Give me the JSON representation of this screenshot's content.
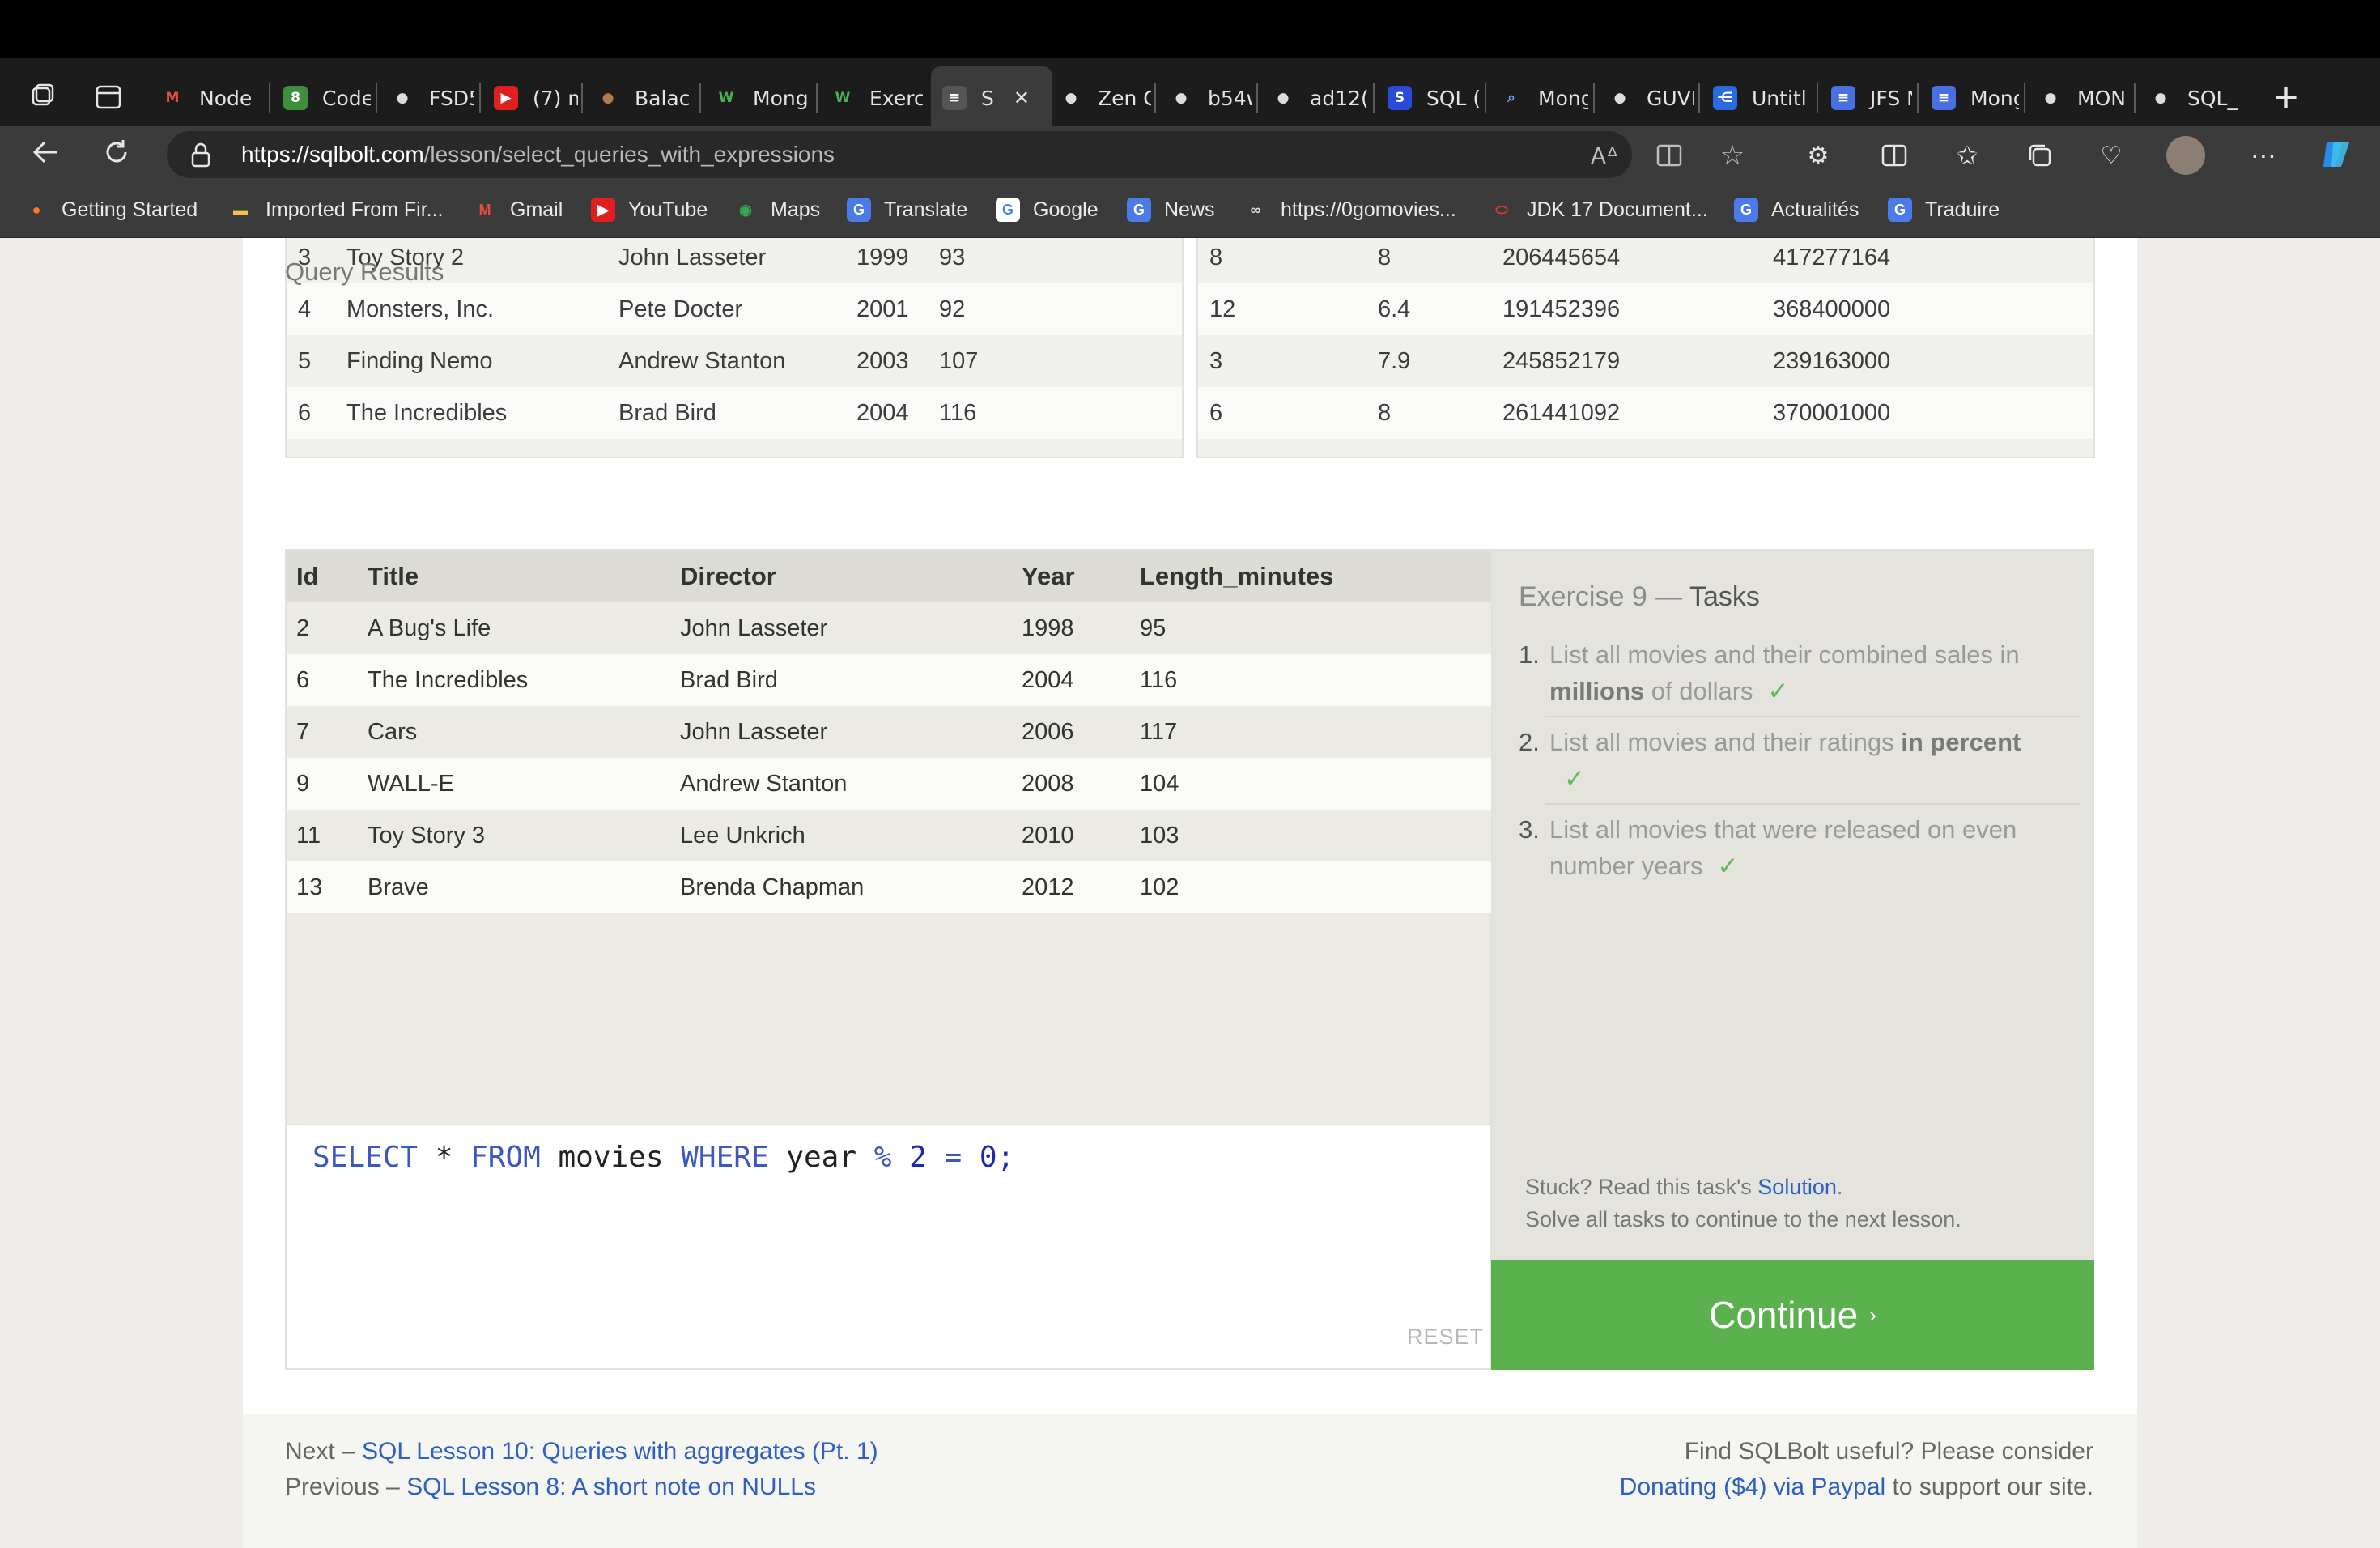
{
  "browser": {
    "tabs": [
      {
        "label": "Node",
        "icon": "gmail-icon"
      },
      {
        "label": "Code",
        "icon": "code-icon"
      },
      {
        "label": "FSD5",
        "icon": "github-icon"
      },
      {
        "label": "(7) m",
        "icon": "youtube-icon"
      },
      {
        "label": "Balac",
        "icon": "avatar-icon"
      },
      {
        "label": "Mong",
        "icon": "w3schools-icon"
      },
      {
        "label": "Exerc",
        "icon": "w3schools-icon"
      },
      {
        "label": "S",
        "icon": "sqlbolt-icon",
        "active": true
      },
      {
        "label": "Zen C",
        "icon": "github-icon"
      },
      {
        "label": "b54w",
        "icon": "github-icon"
      },
      {
        "label": "ad12(",
        "icon": "github-icon"
      },
      {
        "label": "SQL (",
        "icon": "sql-icon"
      },
      {
        "label": "Mong",
        "icon": "search-icon"
      },
      {
        "label": "GUVI",
        "icon": "github-icon"
      },
      {
        "label": "Untitl",
        "icon": "share-icon"
      },
      {
        "label": "JFS N",
        "icon": "docs-icon"
      },
      {
        "label": "Mong",
        "icon": "docs-icon"
      },
      {
        "label": "MON",
        "icon": "github-icon"
      },
      {
        "label": "SQL_",
        "icon": "github-icon"
      }
    ],
    "close_tab_glyph": "✕",
    "new_tab_glyph": "+",
    "url_host": "https://sqlbolt.com",
    "url_path": "/lesson/select_queries_with_expressions",
    "bookmarks": [
      {
        "label": "Getting Started",
        "icon": "firefox-icon"
      },
      {
        "label": "Imported From Fir...",
        "icon": "folder-icon"
      },
      {
        "label": "Gmail",
        "icon": "gmail-icon"
      },
      {
        "label": "YouTube",
        "icon": "youtube-icon"
      },
      {
        "label": "Maps",
        "icon": "maps-icon"
      },
      {
        "label": "Translate",
        "icon": "translate-icon"
      },
      {
        "label": "Google",
        "icon": "google-icon"
      },
      {
        "label": "News",
        "icon": "news-icon"
      },
      {
        "label": "https://0gomovies...",
        "icon": "movies-icon"
      },
      {
        "label": "JDK 17 Document...",
        "icon": "oracle-icon"
      },
      {
        "label": "Actualités",
        "icon": "news-icon"
      },
      {
        "label": "Traduire",
        "icon": "translate-icon"
      }
    ]
  },
  "movies_table": {
    "rows": [
      [
        "3",
        "Toy Story 2",
        "John Lasseter",
        "1999",
        "93"
      ],
      [
        "4",
        "Monsters, Inc.",
        "Pete Docter",
        "2001",
        "92"
      ],
      [
        "5",
        "Finding Nemo",
        "Andrew Stanton",
        "2003",
        "107"
      ],
      [
        "6",
        "The Incredibles",
        "Brad Bird",
        "2004",
        "116"
      ]
    ]
  },
  "boxoffice_table": {
    "rows": [
      [
        "8",
        "8",
        "206445654",
        "417277164"
      ],
      [
        "12",
        "6.4",
        "191452396",
        "368400000"
      ],
      [
        "3",
        "7.9",
        "245852179",
        "239163000"
      ],
      [
        "6",
        "8",
        "261441092",
        "370001000"
      ]
    ]
  },
  "results": {
    "label": "Query Results",
    "columns": [
      "Id",
      "Title",
      "Director",
      "Year",
      "Length_minutes"
    ],
    "rows": [
      [
        "2",
        "A Bug's Life",
        "John Lasseter",
        "1998",
        "95"
      ],
      [
        "6",
        "The Incredibles",
        "Brad Bird",
        "2004",
        "116"
      ],
      [
        "7",
        "Cars",
        "John Lasseter",
        "2006",
        "117"
      ],
      [
        "9",
        "WALL-E",
        "Andrew Stanton",
        "2008",
        "104"
      ],
      [
        "11",
        "Toy Story 3",
        "Lee Unkrich",
        "2010",
        "103"
      ],
      [
        "13",
        "Brave",
        "Brenda Chapman",
        "2012",
        "102"
      ]
    ]
  },
  "editor": {
    "query": "SELECT * FROM movies WHERE year % 2 = 0;",
    "reset_label": "RESET"
  },
  "tasks": {
    "title_prefix": "Exercise 9 — ",
    "title_strong": "Tasks",
    "items": [
      {
        "num": "1.",
        "pre": "List all movies and their combined sales in ",
        "bold": "millions",
        "post": " of dollars",
        "check": "✓"
      },
      {
        "num": "2.",
        "pre": "List all movies and their ratings ",
        "bold": "in percent",
        "post": "",
        "check": "✓"
      },
      {
        "num": "3.",
        "pre": "List all movies that were released on even number years",
        "bold": "",
        "post": "",
        "check": "✓"
      }
    ],
    "stuck_pre": "Stuck? Read this task's ",
    "stuck_link": "Solution",
    "stuck_post": ".",
    "solve_all": "Solve all tasks to continue to the next lesson.",
    "continue_label": "Continue",
    "continue_arrow": "›"
  },
  "footer": {
    "next_prefix": "Next – ",
    "next_link": "SQL Lesson 10: Queries with aggregates (Pt. 1)",
    "prev_prefix": "Previous – ",
    "prev_link": "SQL Lesson 8: A short note on NULLs",
    "useful": "Find SQLBolt useful? Please consider",
    "donate_link": "Donating ($4) via Paypal",
    "donate_post": " to support our site."
  },
  "colors": {
    "accent_green": "#5cb14f",
    "link_blue": "#2e5fc2",
    "keyword_blue": "#3a57c5",
    "check_green": "#5fb85a"
  }
}
